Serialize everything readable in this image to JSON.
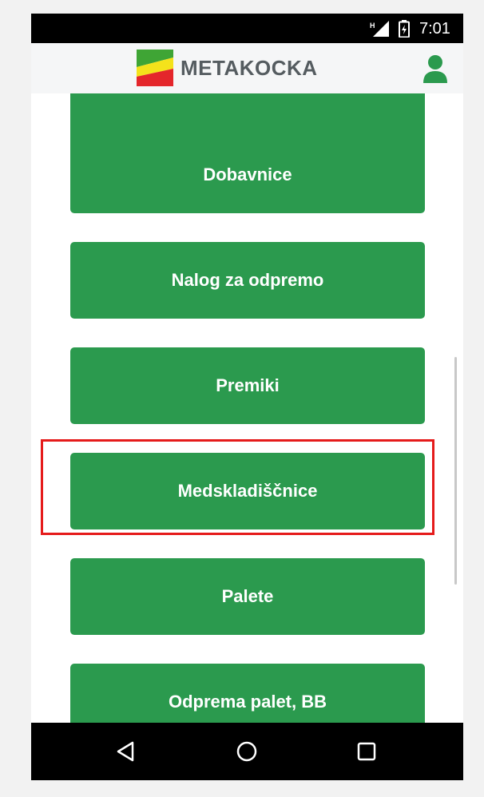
{
  "status_bar": {
    "time": "7:01",
    "network_type": "H"
  },
  "header": {
    "logo_text": "METAKOCKA",
    "user_icon": "user-icon"
  },
  "menu": {
    "items": [
      {
        "label": ""
      },
      {
        "label": "Dobavnice"
      },
      {
        "label": "Nalog za odpremo"
      },
      {
        "label": "Premiki"
      },
      {
        "label": "Medskladiščnice",
        "highlighted": true
      },
      {
        "label": "Palete"
      },
      {
        "label": "Odprema palet, BB"
      }
    ]
  },
  "colors": {
    "button_green": "#2b9a4e",
    "highlight_red": "#e51b1b",
    "header_bg": "#f5f6f7"
  },
  "nav_bar": {
    "icons": [
      "back-icon",
      "home-icon",
      "recents-icon"
    ]
  }
}
